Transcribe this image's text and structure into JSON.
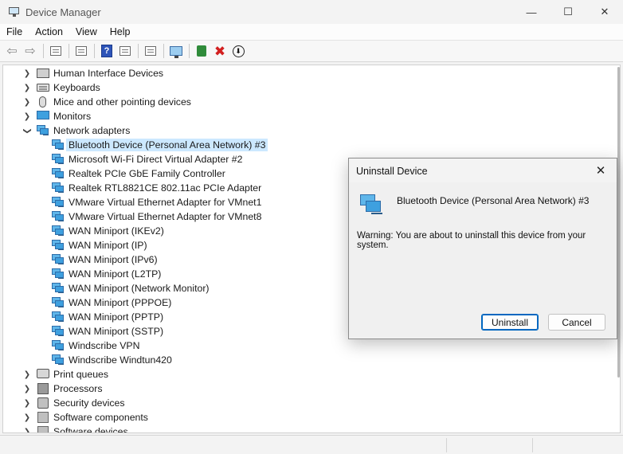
{
  "window": {
    "title": "Device Manager",
    "minimize_glyph": "—",
    "maximize_glyph": "☐",
    "close_glyph": "✕"
  },
  "menu": [
    "File",
    "Action",
    "View",
    "Help"
  ],
  "toolbar": {
    "icons": [
      "back-arrow-icon",
      "forward-arrow-icon",
      "properties-icon",
      "list-icon",
      "help-icon",
      "resource-icon",
      "update-driver-icon",
      "scan-hardware-icon",
      "enable-device-icon",
      "uninstall-device-icon",
      "download-driver-icon"
    ]
  },
  "tree": {
    "categories": [
      {
        "label": "Human Interface Devices",
        "expanded": false,
        "icon": "hid-icon"
      },
      {
        "label": "Keyboards",
        "expanded": false,
        "icon": "keyboard-icon"
      },
      {
        "label": "Mice and other pointing devices",
        "expanded": false,
        "icon": "mouse-icon"
      },
      {
        "label": "Monitors",
        "expanded": false,
        "icon": "monitor-icon"
      },
      {
        "label": "Network adapters",
        "expanded": true,
        "icon": "network-adapter-icon"
      }
    ],
    "network_adapters": [
      "Bluetooth Device (Personal Area Network) #3",
      "Microsoft Wi-Fi Direct Virtual Adapter #2",
      "Realtek PCIe GbE Family Controller",
      "Realtek RTL8821CE 802.11ac PCIe Adapter",
      "VMware Virtual Ethernet Adapter for VMnet1",
      "VMware Virtual Ethernet Adapter for VMnet8",
      "WAN Miniport (IKEv2)",
      "WAN Miniport (IP)",
      "WAN Miniport (IPv6)",
      "WAN Miniport (L2TP)",
      "WAN Miniport (Network Monitor)",
      "WAN Miniport (PPPOE)",
      "WAN Miniport (PPTP)",
      "WAN Miniport (SSTP)",
      "Windscribe VPN",
      "Windscribe Windtun420"
    ],
    "selected_adapter": "Bluetooth Device (Personal Area Network) #3",
    "after_categories": [
      {
        "label": "Print queues",
        "icon": "printer-icon"
      },
      {
        "label": "Processors",
        "icon": "processor-icon"
      },
      {
        "label": "Security devices",
        "icon": "security-device-icon"
      },
      {
        "label": "Software components",
        "icon": "software-component-icon"
      },
      {
        "label": "Software devices",
        "icon": "software-device-icon"
      }
    ]
  },
  "dialog": {
    "title": "Uninstall Device",
    "device_name": "Bluetooth Device (Personal Area Network) #3",
    "warning": "Warning: You are about to uninstall this device from your system.",
    "uninstall_label": "Uninstall",
    "cancel_label": "Cancel",
    "close_glyph": "✕"
  },
  "colors": {
    "selection": "#cce8ff",
    "primary_button_border": "#0067c0",
    "uninstall_x": "#d21f1f"
  }
}
